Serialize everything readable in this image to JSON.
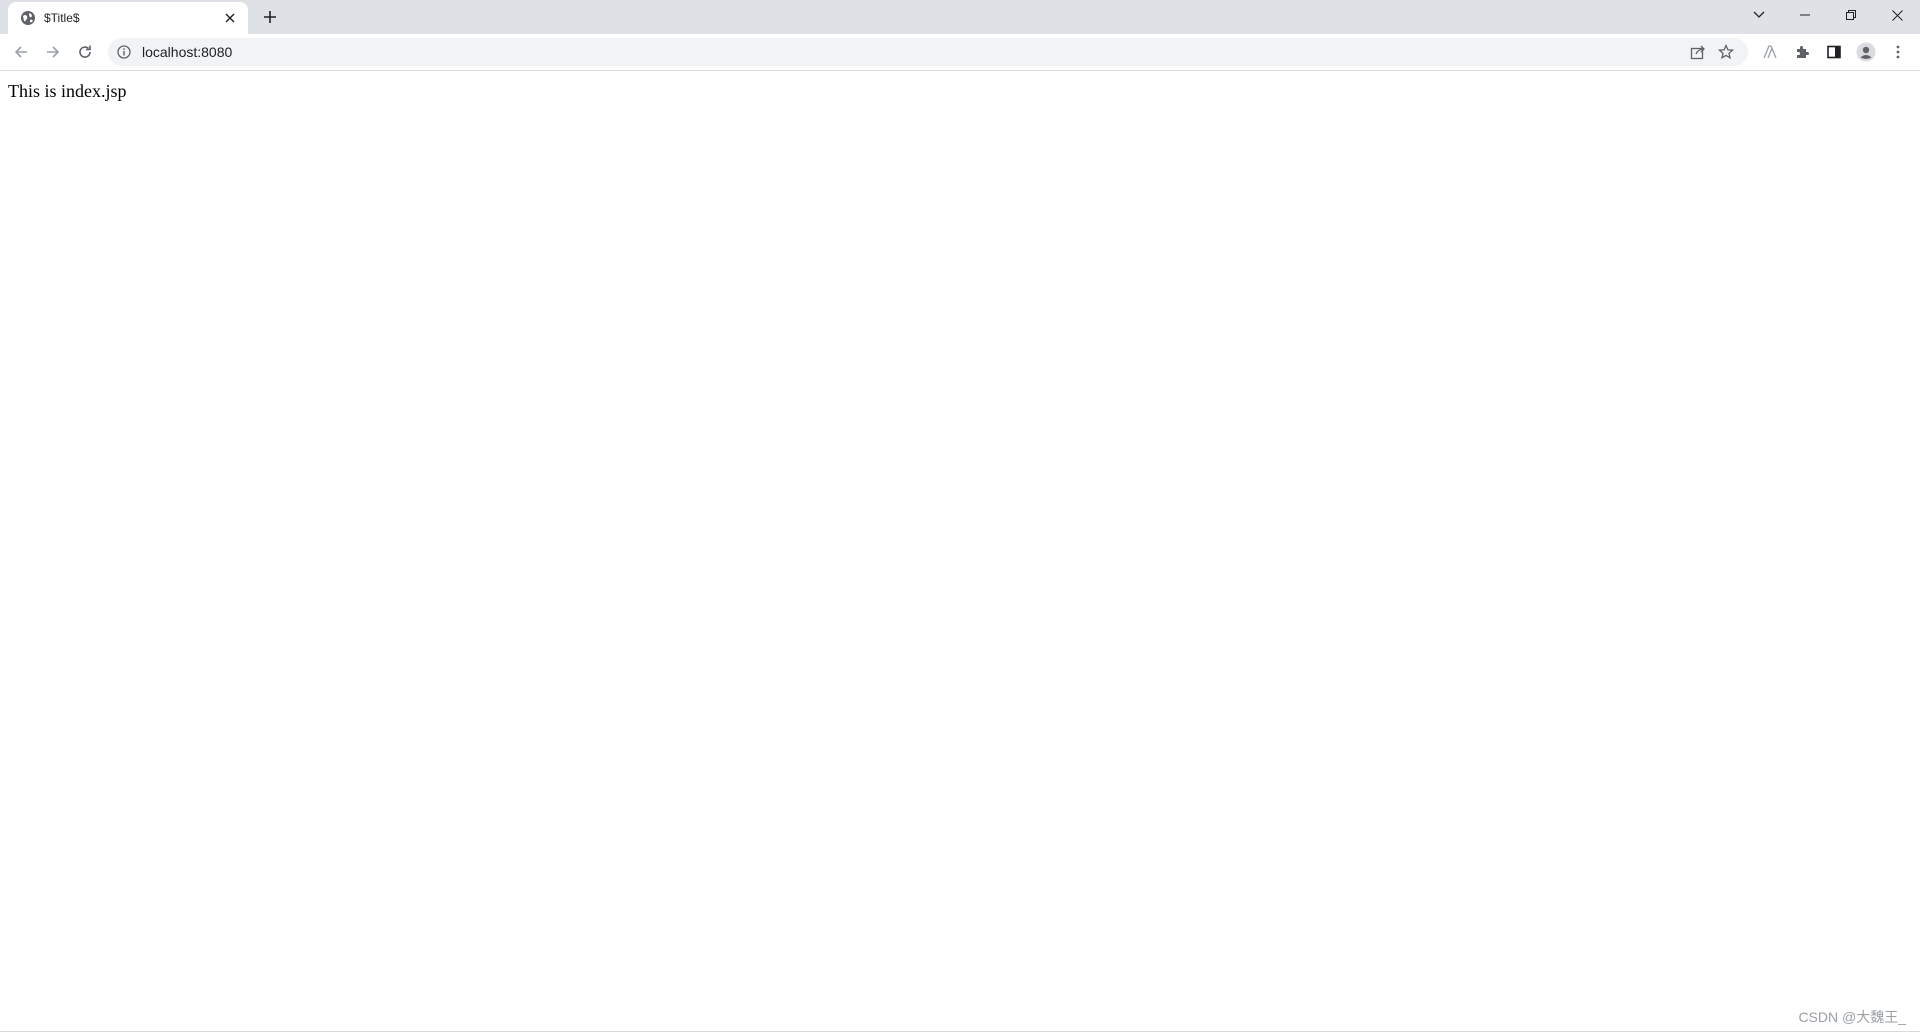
{
  "browser": {
    "tab": {
      "title": "$Title$",
      "favicon": "globe-icon",
      "close_icon": "close-icon"
    },
    "new_tab_icon": "plus-icon",
    "window_controls": [
      "tab-search-icon",
      "minimize-icon",
      "restore-icon",
      "close-icon"
    ],
    "toolbar": {
      "back_icon": "back-arrow-icon",
      "forward_icon": "forward-arrow-icon",
      "reload_icon": "reload-icon",
      "address": "localhost:8080",
      "address_info_icon": "info-icon",
      "right_icons": [
        "share-icon",
        "bookmark-star-icon",
        "extension-a-icon",
        "puzzle-icon",
        "side-panel-icon",
        "profile-avatar-icon",
        "more-menu-icon"
      ]
    }
  },
  "page": {
    "text": "This is index.jsp"
  },
  "watermark": {
    "text": "CSDN @大魏王_"
  },
  "colors": {
    "tabstrip_bg": "#dee1e6",
    "omnibox_bg": "#f1f3f4",
    "icon": "#5f6368",
    "text": "#202124"
  }
}
